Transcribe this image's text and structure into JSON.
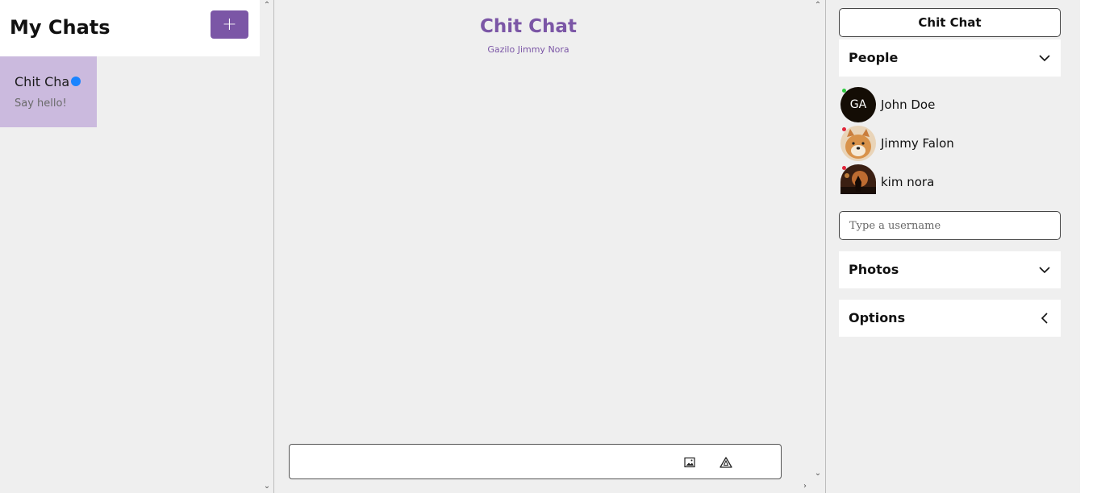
{
  "left": {
    "title": "My Chats",
    "new_chat_label": "+",
    "chats": [
      {
        "title": "Chit Cha",
        "subtitle": "Say hello!",
        "unread": true
      }
    ]
  },
  "chat": {
    "title": "Chit Chat",
    "members": "Gazilo Jimmy Nora",
    "composer_value": ""
  },
  "right": {
    "chat_title": "Chit Chat",
    "people_label": "People",
    "people": [
      {
        "initials": "GA",
        "name": "John Doe",
        "status_color": "#2ecc40"
      },
      {
        "initials": "",
        "name": "Jimmy Falon",
        "status_color": "#e0253a"
      },
      {
        "initials": "",
        "name": "kim nora",
        "status_color": "#e0253a"
      }
    ],
    "username_placeholder": "Type a username",
    "photos_label": "Photos",
    "options_label": "Options"
  },
  "colors": {
    "accent": "#7b56a6",
    "card": "#cbbade",
    "unread_dot": "#1a84ff"
  }
}
